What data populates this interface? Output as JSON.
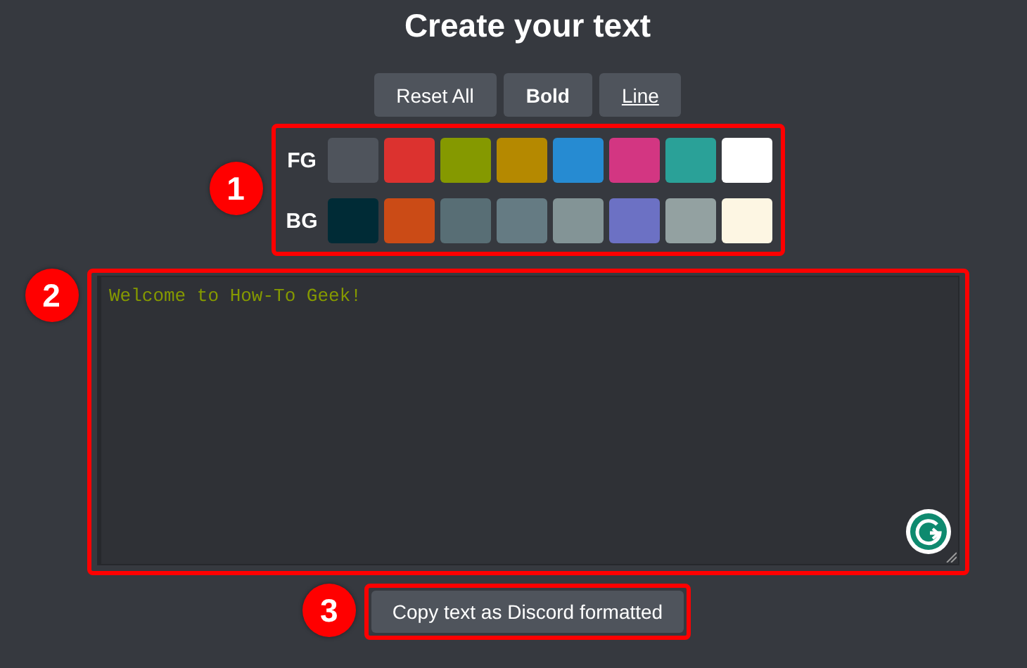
{
  "title": "Create your text",
  "buttons": [
    {
      "label": "Reset All",
      "kind": "plain"
    },
    {
      "label": "Bold",
      "kind": "bold"
    },
    {
      "label": "Line",
      "kind": "underline"
    }
  ],
  "palette": [
    {
      "label": "FG",
      "swatches": [
        {
          "color": "#4f545c"
        },
        {
          "color": "#dc322f"
        },
        {
          "color": "#859900"
        },
        {
          "color": "#b58900"
        },
        {
          "color": "#268bd2"
        },
        {
          "color": "#d33682"
        },
        {
          "color": "#2aa198"
        },
        {
          "color": "#ffffff"
        }
      ]
    },
    {
      "label": "BG",
      "swatches": [
        {
          "color": "#002b36"
        },
        {
          "color": "#cb4b16"
        },
        {
          "color": "#586e75"
        },
        {
          "color": "#657b83"
        },
        {
          "color": "#839496"
        },
        {
          "color": "#6c71c4"
        },
        {
          "color": "#93a1a1"
        },
        {
          "color": "#fdf6e3"
        }
      ]
    }
  ],
  "editor": {
    "value": "Welcome to How-To Geek!",
    "color": "#859900"
  },
  "copy_button": {
    "label": "Copy text as Discord formatted"
  },
  "annotations": [
    "1",
    "2",
    "3"
  ]
}
